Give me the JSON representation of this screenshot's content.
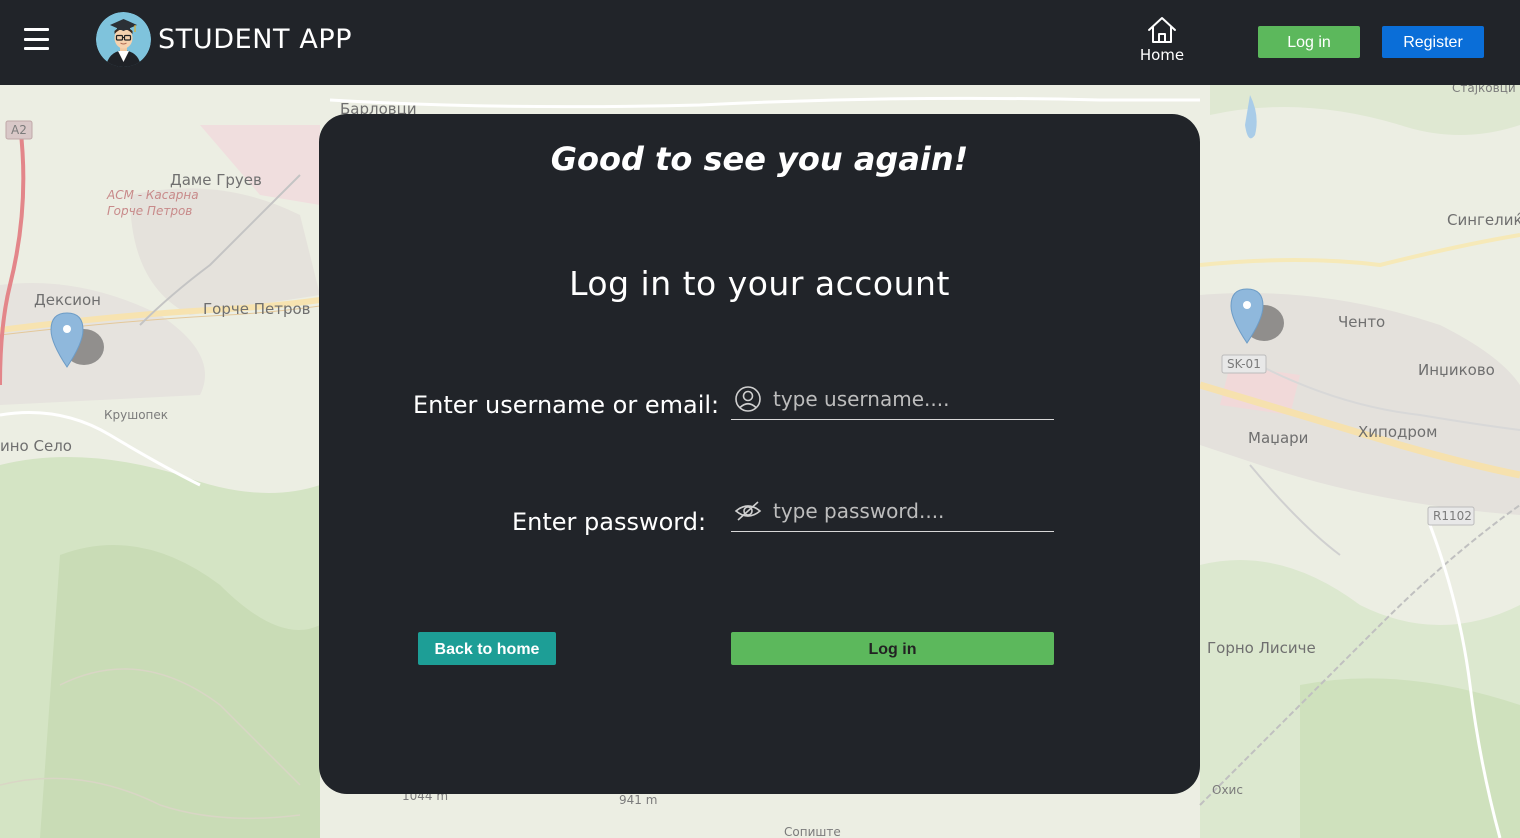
{
  "navbar": {
    "menu_icon": "hamburger-menu-icon",
    "logo_icon": "student-avatar-icon",
    "brand": "STUDENT APP",
    "home_icon": "home-icon",
    "home_label": "Home",
    "login_label": "Log in",
    "register_label": "Register",
    "colors": {
      "background": "#212429",
      "login": "#5cb85c",
      "register": "#0a6ed8"
    }
  },
  "map": {
    "pin_icon": "map-pin-icon",
    "labels": [
      {
        "text": "Барловци"
      },
      {
        "text": "Даме Груев"
      },
      {
        "text": "АСМ - Касарна"
      },
      {
        "text": "Горче Петров"
      },
      {
        "text": "Дексион"
      },
      {
        "text": "Горче Петров"
      },
      {
        "text": "Крушопек"
      },
      {
        "text": "ино Село"
      },
      {
        "text": "Сингелиќ"
      },
      {
        "text": "Ченто"
      },
      {
        "text": "SK-01"
      },
      {
        "text": "Инџиково"
      },
      {
        "text": "Маџари"
      },
      {
        "text": "Хиподром"
      },
      {
        "text": "R1102"
      },
      {
        "text": "Горно Лисиче"
      },
      {
        "text": "A2"
      },
      {
        "text": "Стајковци"
      },
      {
        "text": "1044 m"
      },
      {
        "text": "941 m"
      },
      {
        "text": "Сопиште"
      },
      {
        "text": "Охис"
      }
    ]
  },
  "card": {
    "greeting": "Good to see you again!",
    "title": "Log in to your account",
    "username_label": "Enter username or email:",
    "username_placeholder": "type username....",
    "username_icon": "user-circle-icon",
    "password_label": "Enter password:",
    "password_placeholder": "type password....",
    "password_icon": "eye-slash-icon",
    "back_label": "Back to home",
    "login_label": "Log in",
    "colors": {
      "card": "#212429",
      "back": "#1d9e96",
      "login": "#5cb85c"
    }
  }
}
